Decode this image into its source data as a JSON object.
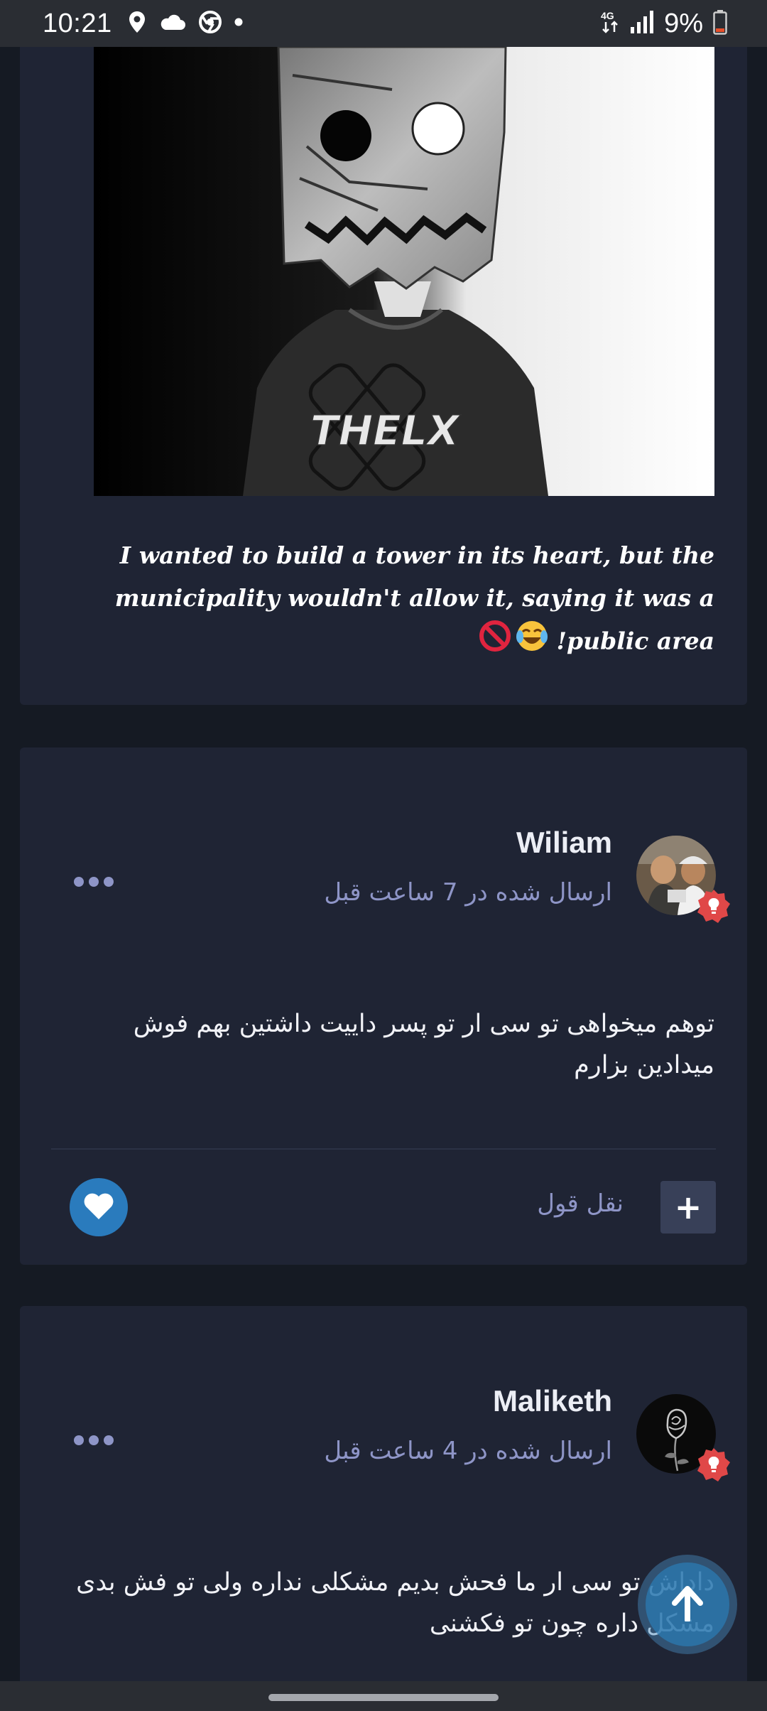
{
  "status_bar": {
    "time": "10:21",
    "left_icons": [
      "location-icon",
      "cloud-icon",
      "chrome-icon",
      "dot-icon"
    ],
    "network": "4G",
    "battery": "9%"
  },
  "posts": [
    {
      "caption": "I wanted to build a tower in its heart, but the municipality wouldn't allow it, saying it was a public area!",
      "caption_emojis": [
        "😂",
        "🚫"
      ],
      "image_text": "THELX"
    },
    {
      "author": "Wiliam",
      "meta": "ارسال شده در 7 ساعت قبل",
      "body": "توهم میخواهی تو سی ار تو پسر داییت داشتین بهم فوش میدادین بزارم",
      "quote_label": "نقل قول",
      "plus_label": "+"
    },
    {
      "author": "Maliketh",
      "meta": "ارسال شده در 4 ساعت قبل",
      "body": "داداش تو سی ار ما فحش بدیم مشکلی نداره ولی تو فش بدی مشکل داره چون تو فکشنی"
    }
  ],
  "colors": {
    "background": "#151a23",
    "card": "#1f2434",
    "muted_text": "#8e95c7",
    "like_button": "#2a7bbd",
    "badge": "#e04848"
  }
}
